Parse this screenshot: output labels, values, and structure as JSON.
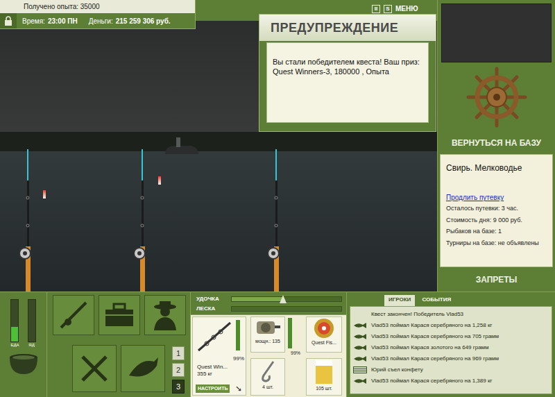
{
  "hud": {
    "experience": "Получено опыта: 35000",
    "time_label": "Время:",
    "time": "23:00 ПН",
    "money_label": "Деньги:",
    "money": "215 259 306 руб."
  },
  "top_menu": [
    {
      "label": "II"
    },
    {
      "label": "S"
    },
    {
      "label": "МЕНЮ"
    }
  ],
  "scene": {
    "rods": [
      {
        "float": true
      },
      {
        "float": true
      },
      {
        "float": false
      }
    ]
  },
  "warning": {
    "title": "ПРЕДУПРЕЖДЕНИЕ",
    "message": "Вы стали победителем квеста! Ваш приз: Quest Winners-3, 180000 , Опыта"
  },
  "side": {
    "return_button": "ВЕРНУТЬСЯ НА БАЗУ",
    "location": "Свирь. Мелководье",
    "extend_link": "Продлить путевку",
    "details": [
      "Осталось путевки: 3 час.",
      "Стоимость дня: 9 000 руб.",
      "Рыбаков на базе: 1",
      "Турниры на базе: не объявлены"
    ],
    "bans_button": "ЗАПРЕТЫ"
  },
  "needs": [
    {
      "label": "ЕДА",
      "level": 0.35
    },
    {
      "label": "ЯД",
      "level": 0
    }
  ],
  "rod_slots": [
    {
      "label": "1",
      "selected": false
    },
    {
      "label": "2",
      "selected": false
    },
    {
      "label": "3",
      "selected": true
    }
  ],
  "sliders": [
    {
      "label": "УДОЧКА",
      "level": 0.47
    },
    {
      "label": "ЛЕСКА",
      "level": 0
    }
  ],
  "tackle": {
    "rod": {
      "name": "Quest Win...",
      "weight": "355 кг",
      "condition": "99%",
      "level": 0.99,
      "setup_button": "НАСТРОИТЬ"
    },
    "reel": {
      "power": "мощн.: 135",
      "condition": "99%",
      "level": 0.99
    },
    "line": {
      "name": "Quest Fis..."
    },
    "hook": {
      "count": "4 шт."
    },
    "bait": {
      "count": "105 шт."
    }
  },
  "log": {
    "tabs": [
      {
        "label": "ИГРОКИ",
        "selected": true
      },
      {
        "label": "СОБЫТИЯ",
        "selected": false
      }
    ],
    "entries": [
      {
        "text": "Квест закончен! Победитель Vlad53",
        "kind": "notice"
      },
      {
        "text": "Vlad53 поймал Карася серебряного на 1,258 кг",
        "kind": "catch"
      },
      {
        "text": "Vlad53 поймал Карася серебряного на 705 грамм",
        "kind": "catch"
      },
      {
        "text": "Vlad53 поймал Карася золотого на 649 грамм",
        "kind": "catch"
      },
      {
        "text": "Vlad53 поймал Карася серебряного на 969 грамм",
        "kind": "catch"
      },
      {
        "text": "Юрий съел конфету",
        "kind": "eat"
      },
      {
        "text": "Vlad53 поймал Карася серебряного на 1,389 кг",
        "kind": "catch"
      }
    ]
  }
}
